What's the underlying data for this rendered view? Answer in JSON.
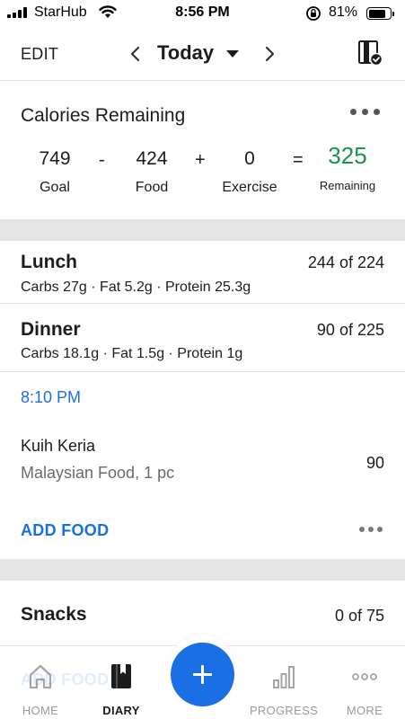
{
  "status_bar": {
    "carrier": "StarHub",
    "time": "8:56 PM",
    "battery": "81%",
    "battery_level": 0.81
  },
  "header": {
    "edit_label": "EDIT",
    "day_title": "Today",
    "icons": [
      "chevron-left-icon",
      "caret-down-icon",
      "chevron-right-icon",
      "diary-check-icon"
    ]
  },
  "calories": {
    "title": "Calories Remaining",
    "goal_value": "749",
    "goal_label": "Goal",
    "minus": "-",
    "food_value": "424",
    "food_label": "Food",
    "plus": "+",
    "exercise_value": "0",
    "exercise_label": "Exercise",
    "equals": "=",
    "remaining_value": "325",
    "remaining_label": "Remaining",
    "remaining_color": "#1a9452"
  },
  "meals": {
    "lunch": {
      "name": "Lunch",
      "calories": "244 of 224",
      "macros": "Carbs 27g · Fat 5.2g · Protein 25.3g"
    },
    "dinner": {
      "name": "Dinner",
      "calories": "90 of 225",
      "macros": "Carbs 18.1g · Fat 1.5g · Protein 1g",
      "entry_time": "8:10 PM",
      "food": {
        "name": "Kuih Keria",
        "description": "Malaysian Food, 1 pc",
        "calories": "90"
      },
      "add_food_label": "ADD FOOD"
    },
    "snacks": {
      "name": "Snacks",
      "calories": "0 of 75",
      "add_food_label": "ADD FOOD"
    }
  },
  "tabbar": {
    "tabs": [
      {
        "label": "HOME",
        "icon": "home-icon"
      },
      {
        "label": "DIARY",
        "icon": "diary-icon",
        "active": true
      },
      {
        "label": "PROGRESS",
        "icon": "bar-chart-icon"
      },
      {
        "label": "MORE",
        "icon": "more-dots-icon"
      }
    ],
    "add_icon": "plus-icon"
  },
  "colors": {
    "accent_blue": "#1b6fe5",
    "remaining_green": "#1a9452",
    "separator_gray": "#e5e5e5"
  }
}
